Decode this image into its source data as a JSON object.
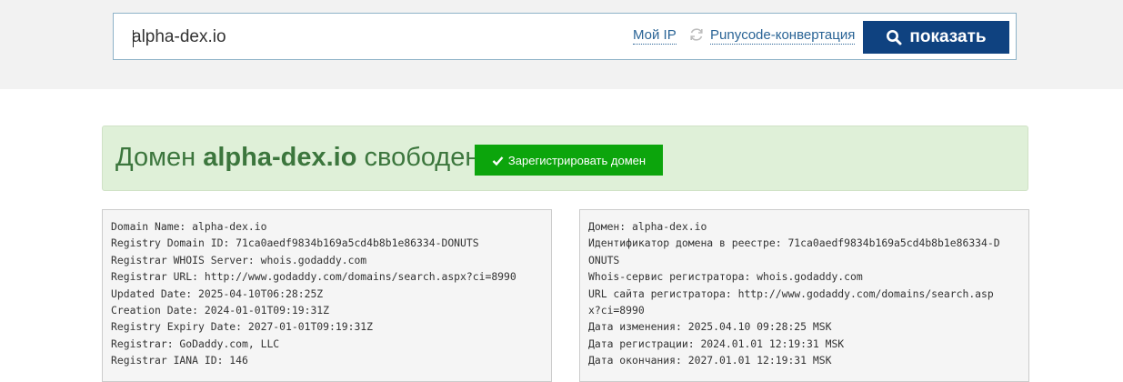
{
  "search": {
    "value": "alpha-dex.io",
    "my_ip_label": "Мой IP",
    "punycode_label": "Punycode-конвертация",
    "show_label": "показать"
  },
  "status": {
    "prefix": "Домен ",
    "domain": "alpha-dex.io",
    "suffix": " свободен",
    "register_label": "Зарегистрировать домен"
  },
  "whois_raw": [
    "Domain Name: alpha-dex.io",
    "Registry Domain ID: 71ca0aedf9834b169a5cd4b8b1e86334-DONUTS",
    "Registrar WHOIS Server: whois.godaddy.com",
    "Registrar URL: http://www.godaddy.com/domains/search.aspx?ci=8990",
    "Updated Date: 2025-04-10T06:28:25Z",
    "Creation Date: 2024-01-01T09:19:31Z",
    "Registry Expiry Date: 2027-01-01T09:19:31Z",
    "Registrar: GoDaddy.com, LLC",
    "Registrar IANA ID: 146"
  ],
  "whois_translated": [
    "Домен: alpha-dex.io",
    "Идентификатор домена в реестре: 71ca0aedf9834b169a5cd4b8b1e86334-D",
    "ONUTS",
    "Whois-сервис регистратора: whois.godaddy.com",
    "URL сайта регистратора: http://www.godaddy.com/domains/search.asp",
    "x?ci=8990",
    "Дата изменения: 2025.04.10 09:28:25 MSK",
    "Дата регистрации: 2024.01.01 12:19:31 MSK",
    "Дата окончания: 2027.01.01 12:19:31 MSK"
  ],
  "colors": {
    "button_primary": "#0f4280",
    "button_success": "#0ca50c",
    "status_bg": "#dff0d8",
    "status_text": "#3c763d",
    "link": "#2a6496"
  },
  "icons": {
    "show_button": "search-icon",
    "punycode": "refresh-icon",
    "register_button": "check-icon"
  }
}
